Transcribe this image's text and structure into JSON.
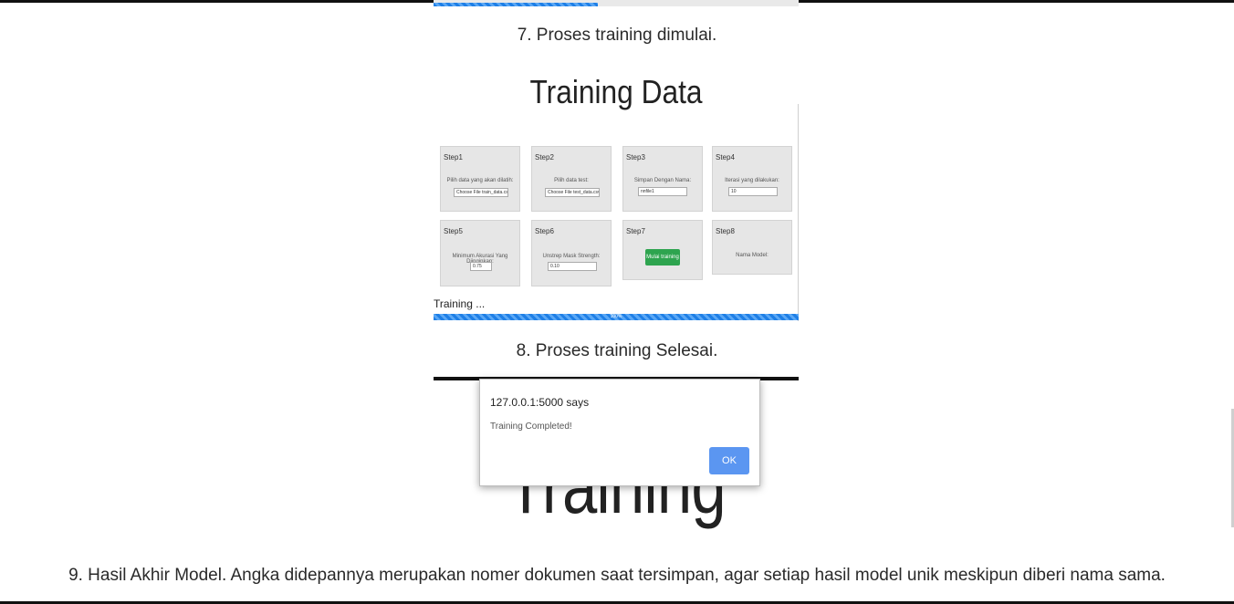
{
  "captions": {
    "step7": "7. Proses training dimulai.",
    "step8": "8. Proses training Selesai.",
    "step9": "9. Hasil Akhir Model. Angka didepannya merupakan nomer dokumen saat tersimpan, agar setiap hasil model unik meskipun diberi nama sama."
  },
  "training_screenshot": {
    "title": "Training Data",
    "cards": [
      {
        "step": "Step1",
        "label": "Pilih data yang akan dilatih:",
        "input_value": "Choose File  train_data.csv"
      },
      {
        "step": "Step2",
        "label": "Pilih data test:",
        "input_value": "Choose File  test_data.csv"
      },
      {
        "step": "Step3",
        "label": "Simpan Dengan Nama:",
        "input_value": "nnfile1"
      },
      {
        "step": "Step4",
        "label": "Iterasi yang dilakukan:",
        "input_value": "10"
      },
      {
        "step": "Step5",
        "label": "Minimum Akurasi Yang Diinginkan:",
        "input_value": "0.75"
      },
      {
        "step": "Step6",
        "label": "Unstrep Mask Strength:",
        "input_value": "0.10"
      },
      {
        "step": "Step7",
        "button_label": "Mulai training"
      },
      {
        "step": "Step8",
        "label": "Nama Model:"
      }
    ],
    "status_text": "Training ...",
    "progress_label": "100%",
    "progress_fraction": 1.0
  },
  "completed_screenshot": {
    "bg_title": "Training Data",
    "dialog": {
      "origin": "127.0.0.1:5000 says",
      "message": "Training Completed!",
      "ok_label": "OK"
    }
  }
}
